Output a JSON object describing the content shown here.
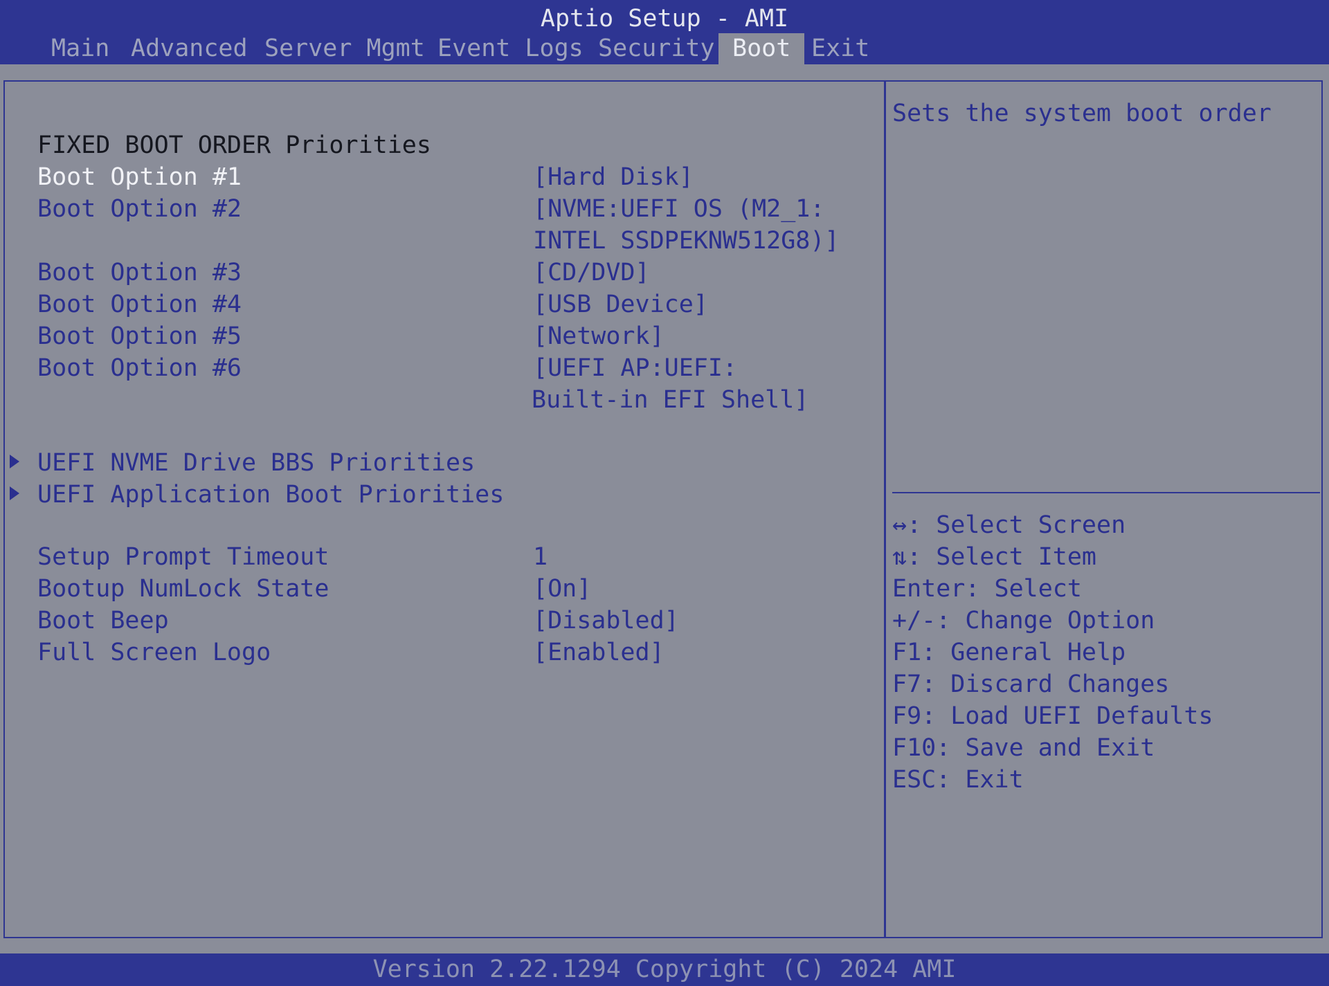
{
  "header": {
    "title": "Aptio Setup - AMI",
    "tabs": [
      {
        "label": "Main"
      },
      {
        "label": "Advanced"
      },
      {
        "label": "Server Mgmt"
      },
      {
        "label": "Event Logs"
      },
      {
        "label": "Security"
      },
      {
        "label": "Boot"
      },
      {
        "label": "Exit"
      }
    ],
    "active_tab": "Boot"
  },
  "main": {
    "section_title": "FIXED BOOT ORDER Priorities",
    "boot_options": [
      {
        "label": "Boot Option #1",
        "value_lines": [
          "[Hard Disk]"
        ],
        "selected": true
      },
      {
        "label": "Boot Option #2",
        "value_lines": [
          "[NVME:UEFI OS (M2_1:",
          "INTEL SSDPEKNW512G8)]"
        ]
      },
      {
        "label": "Boot Option #3",
        "value_lines": [
          "[CD/DVD]"
        ]
      },
      {
        "label": "Boot Option #4",
        "value_lines": [
          "[USB Device]"
        ]
      },
      {
        "label": "Boot Option #5",
        "value_lines": [
          "[Network]"
        ]
      },
      {
        "label": "Boot Option #6",
        "value_lines": [
          "[UEFI AP:UEFI:",
          "Built-in EFI Shell]"
        ]
      }
    ],
    "submenus": [
      {
        "label": "UEFI NVME Drive BBS Priorities"
      },
      {
        "label": "UEFI Application Boot Priorities"
      }
    ],
    "settings": [
      {
        "label": "Setup Prompt Timeout",
        "value": "1"
      },
      {
        "label": "Bootup NumLock State",
        "value": "[On]"
      },
      {
        "label": "Boot Beep",
        "value": "[Disabled]"
      },
      {
        "label": "Full Screen Logo",
        "value": "[Enabled]"
      }
    ]
  },
  "help": {
    "description": "Sets the system boot order",
    "keys": [
      "↔: Select Screen",
      "⇅: Select Item",
      "Enter: Select",
      "+/-: Change Option",
      "F1: General Help",
      "F7: Discard Changes",
      "F9: Load UEFI Defaults",
      "F10: Save and Exit",
      "ESC: Exit"
    ]
  },
  "footer": {
    "version": "Version 2.22.1294 Copyright (C) 2024 AMI"
  },
  "colors": {
    "bar_blue": "#2e3592",
    "panel_gray": "#8a8d99",
    "text_blue": "#2a2f8f",
    "selected_white": "#f1f2f6"
  }
}
